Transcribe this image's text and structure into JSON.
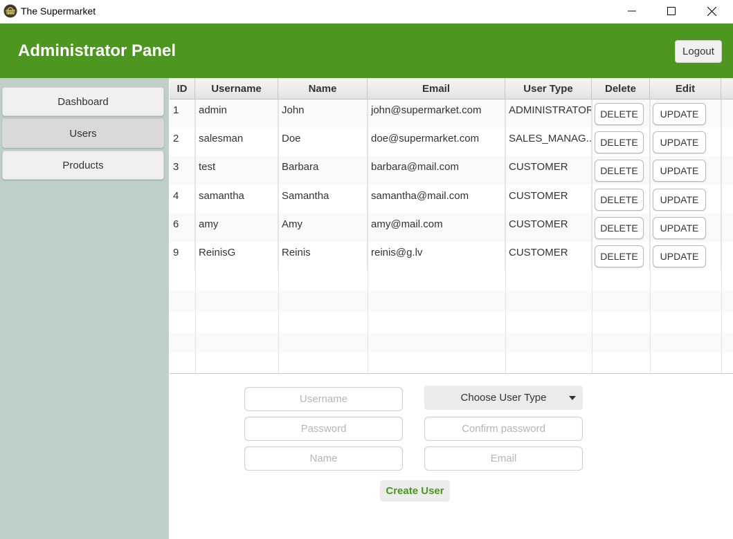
{
  "window": {
    "title": "The Supermarket",
    "icon": "basket-icon"
  },
  "header": {
    "title": "Administrator Panel",
    "logout_label": "Logout"
  },
  "sidebar": {
    "items": [
      {
        "label": "Dashboard",
        "active": false
      },
      {
        "label": "Users",
        "active": true
      },
      {
        "label": "Products",
        "active": false
      }
    ]
  },
  "table": {
    "columns": [
      "ID",
      "Username",
      "Name",
      "Email",
      "User Type",
      "Delete",
      "Edit"
    ],
    "rows": [
      {
        "id": "1",
        "username": "admin",
        "name": "John",
        "email": "john@supermarket.com",
        "user_type": "ADMINISTRATOR",
        "delete_label": "DELETE",
        "edit_label": "UPDATE"
      },
      {
        "id": "2",
        "username": "salesman",
        "name": "Doe",
        "email": "doe@supermarket.com",
        "user_type": "SALES_MANAG...",
        "delete_label": "DELETE",
        "edit_label": "UPDATE"
      },
      {
        "id": "3",
        "username": "test",
        "name": "Barbara",
        "email": "barbara@mail.com",
        "user_type": "CUSTOMER",
        "delete_label": "DELETE",
        "edit_label": "UPDATE"
      },
      {
        "id": "4",
        "username": "samantha",
        "name": "Samantha",
        "email": "samantha@mail.com",
        "user_type": "CUSTOMER",
        "delete_label": "DELETE",
        "edit_label": "UPDATE"
      },
      {
        "id": "6",
        "username": "amy",
        "name": "Amy",
        "email": "amy@mail.com",
        "user_type": "CUSTOMER",
        "delete_label": "DELETE",
        "edit_label": "UPDATE"
      },
      {
        "id": "9",
        "username": "ReinisG",
        "name": "Reinis",
        "email": "reinis@g.lv",
        "user_type": "CUSTOMER",
        "delete_label": "DELETE",
        "edit_label": "UPDATE"
      }
    ]
  },
  "form": {
    "username_placeholder": "Username",
    "password_placeholder": "Password",
    "name_placeholder": "Name",
    "user_type_label": "Choose User Type",
    "confirm_password_placeholder": "Confirm password",
    "email_placeholder": "Email",
    "create_label": "Create User"
  },
  "colors": {
    "header_bg": "#4d961f",
    "sidebar_bg": "#bfcfca",
    "accent_text": "#4d961f"
  }
}
